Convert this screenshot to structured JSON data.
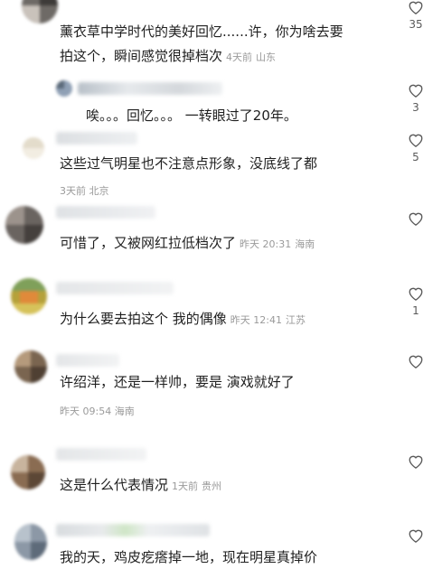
{
  "comments": [
    {
      "line1": "薰衣草中学时代的美好回忆......许，你为啥去要",
      "line2": "拍这个，瞬间感觉很掉档次",
      "time": "4天前",
      "location": "山东",
      "likes": "35"
    },
    {
      "text": "唉。。。回忆。。。   一转眼过了20年。",
      "likes": "3"
    },
    {
      "text": "这些过气明星也不注意点形象，没底线了都",
      "time": "3天前",
      "location": "北京",
      "likes": "5"
    },
    {
      "text": "可惜了，又被网红拉低档次了",
      "time": "昨天 20:31",
      "location": "海南",
      "likes": ""
    },
    {
      "text": "为什么要去拍这个   我的偶像",
      "time": "昨天 12:41",
      "location": "江苏",
      "likes": "1"
    },
    {
      "text": "许绍洋，还是一样帅，要是 演戏就好了",
      "time": "昨天 09:54",
      "location": "海南",
      "likes": ""
    },
    {
      "text": "这是什么代表情况",
      "time": "1天前",
      "location": "贵州",
      "likes": ""
    },
    {
      "text": "我的天，鸡皮疙瘩掉一地，现在明星真掉价",
      "likes": ""
    }
  ],
  "icons": {
    "like": "heart-outline-icon"
  },
  "colors": {
    "text": "#1f1f1f",
    "meta": "#9a9a9a",
    "icon": "#5a5a5a"
  }
}
